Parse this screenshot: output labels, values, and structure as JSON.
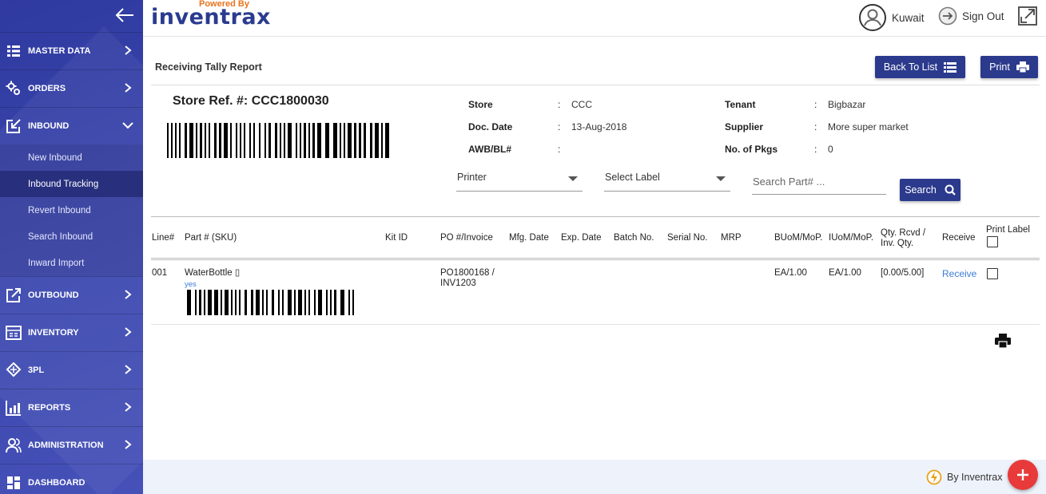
{
  "brand": {
    "powered_by": "Powered By",
    "name": "inventrax"
  },
  "header": {
    "user": "Kuwait",
    "signout": "Sign Out"
  },
  "sidebar": {
    "items": [
      {
        "label": "MASTER DATA",
        "icon": "grid-list-icon"
      },
      {
        "label": "ORDERS",
        "icon": "gears-icon"
      },
      {
        "label": "INBOUND",
        "icon": "inbound-icon"
      },
      {
        "label": "OUTBOUND",
        "icon": "outbound-icon"
      },
      {
        "label": "INVENTORY",
        "icon": "inventory-icon"
      },
      {
        "label": "3PL",
        "icon": "diamond-icon"
      },
      {
        "label": "REPORTS",
        "icon": "reports-icon"
      },
      {
        "label": "ADMINISTRATION",
        "icon": "users-icon"
      },
      {
        "label": "DASHBOARD",
        "icon": "dashboard-icon"
      }
    ],
    "inbound_sub": [
      "New Inbound",
      "Inbound Tracking",
      "Revert Inbound",
      "Search Inbound",
      "Inward Import"
    ]
  },
  "page": {
    "title": "Receiving Tally Report",
    "back_label": "Back To List",
    "print_label": "Print"
  },
  "store_ref": "Store Ref. #: CCC1800030",
  "info": {
    "store_label": "Store",
    "store_value": "CCC",
    "doc_date_label": "Doc. Date",
    "doc_date_value": "13-Aug-2018",
    "awb_label": "AWB/BL#",
    "awb_value": "",
    "tenant_label": "Tenant",
    "tenant_value": "Bigbazar",
    "supplier_label": "Supplier",
    "supplier_value": "More super market",
    "pkgs_label": "No. of Pkgs",
    "pkgs_value": "0",
    "colon": ":"
  },
  "filters": {
    "printer": "Printer",
    "label": "Select Label",
    "search_placeholder": "Search Part# ...",
    "search_button": "Search"
  },
  "table": {
    "headers": {
      "line": "Line#",
      "part": "Part # (SKU)",
      "kit": "Kit ID",
      "po": "PO #/Invoice",
      "mfg": "Mfg. Date",
      "exp": "Exp. Date",
      "batch": "Batch No.",
      "serial": "Serial No.",
      "mrp": "MRP",
      "buom": "BUoM/MoP.",
      "iuom": "IUoM/MoP.",
      "qty": "Qty. Rcvd / Inv. Qty.",
      "receive": "Receive",
      "print_label": "Print Label"
    },
    "row": {
      "line": "001",
      "part": "WaterBottle ▯",
      "yes": "yes",
      "po": "PO1800168 / INV1203",
      "buom": "EA/1.00",
      "iuom": "EA/1.00",
      "qty": "[0.00/5.00]",
      "receive": "Receive"
    }
  },
  "footer": {
    "by": "By Inventrax"
  },
  "colors": {
    "sidebar": "#3a46ad",
    "button": "#2b3a8c",
    "link": "#3b7dd8",
    "fab": "#e83a3a"
  }
}
